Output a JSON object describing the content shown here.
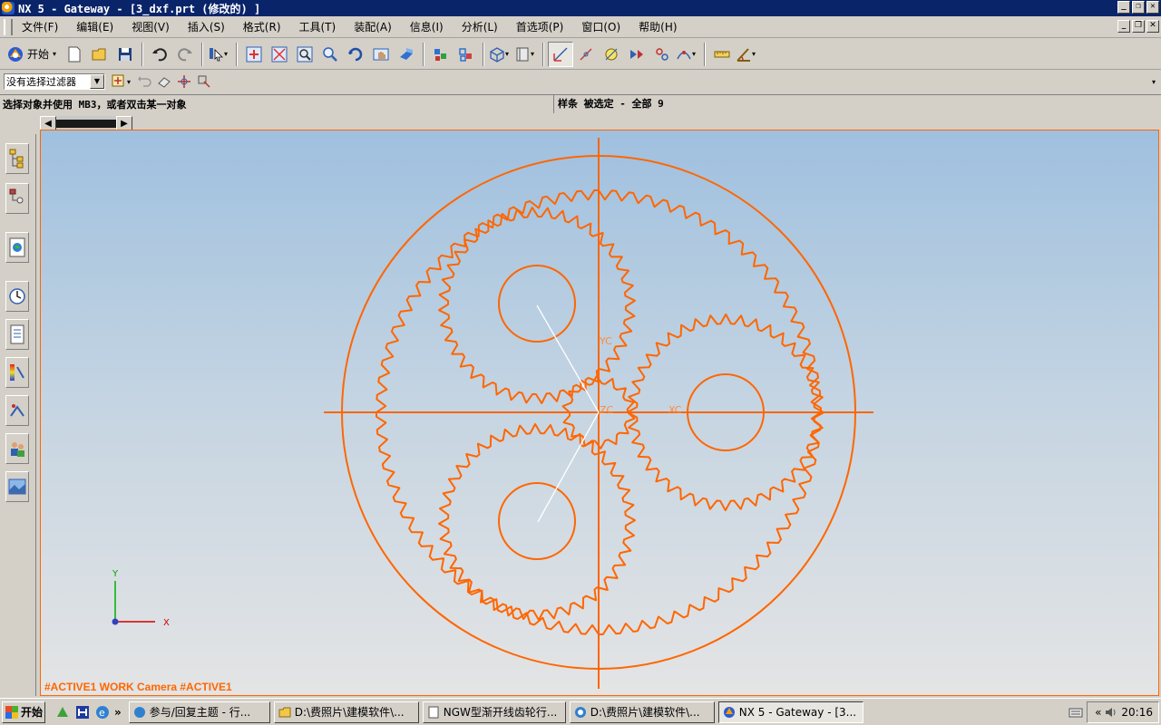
{
  "window": {
    "title": "NX 5 - Gateway - [3_dxf.prt (修改的) ]"
  },
  "menubar": {
    "items": [
      "文件(F)",
      "编辑(E)",
      "视图(V)",
      "插入(S)",
      "格式(R)",
      "工具(T)",
      "装配(A)",
      "信息(I)",
      "分析(L)",
      "首选项(P)",
      "窗口(O)",
      "帮助(H)"
    ]
  },
  "toolbar": {
    "start_label": "开始"
  },
  "selection": {
    "filter_value": "没有选择过滤器"
  },
  "cueline": {
    "cue": "选择对象并使用 MB3，或者双击某一对象",
    "status": "样条 被选定 - 全部 9"
  },
  "viewport": {
    "view_label": "#ACTIVE1 WORK Camera #ACTIVE1",
    "wcs_labels": {
      "yc": "YC",
      "xc": "XC",
      "zc": "ZC"
    },
    "triad_labels": {
      "x": "X",
      "y": "Y"
    },
    "colors": {
      "geometry": "#ff6600",
      "background_top": "#9fc0df",
      "background_bottom": "#e4e4e4",
      "selection_line": "#ffffff"
    }
  },
  "taskbar": {
    "start_label": "开始",
    "tasks": [
      {
        "label": "参与/回复主题 - 行..."
      },
      {
        "label": "D:\\费照片\\建模软件\\..."
      },
      {
        "label": "NGW型渐开线齿轮行..."
      },
      {
        "label": "D:\\费照片\\建模软件\\..."
      },
      {
        "label": "NX 5 - Gateway - [3..."
      }
    ],
    "clock": "20:16"
  }
}
